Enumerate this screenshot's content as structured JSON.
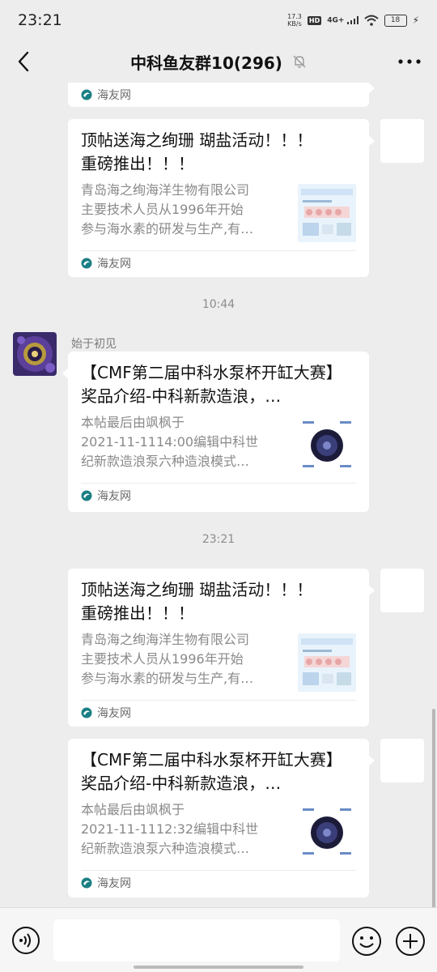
{
  "status_bar": {
    "time": "23:21",
    "net_speed_value": "17.3",
    "net_speed_unit": "KB/s",
    "hd": "HD",
    "signal": "4G+",
    "battery": "18"
  },
  "header": {
    "title": "中科鱼友群10(296)",
    "icons": [
      "back-arrow-icon",
      "mute-bell-icon",
      "more-icon"
    ]
  },
  "messages": {
    "m0": {
      "source": "海友网"
    },
    "m1": {
      "title": "顶帖送海之绚珊 瑚盐活动！！！\n重磅推出！！！",
      "desc": "青岛海之绚海洋生物有限公司\n主要技术人员从1996年开始\n参与海水素的研发与生产,有…",
      "source": "海友网"
    },
    "time1": "10:44",
    "m2": {
      "sender": "始于初见",
      "title": "【CMF第二届中科水泵杯开缸大赛】奖品介绍-中科新款造浪，…",
      "desc": "本帖最后由飒枫于\n2021-11-1114:00编辑中科世\n纪新款造浪泵六种造浪模式…",
      "source": "海友网"
    },
    "time2": "23:21",
    "m3": {
      "title": "顶帖送海之绚珊 瑚盐活动！！！\n重磅推出！！！",
      "desc": "青岛海之绚海洋生物有限公司\n主要技术人员从1996年开始\n参与海水素的研发与生产,有…",
      "source": "海友网"
    },
    "m4": {
      "title": "【CMF第二届中科水泵杯开缸大赛】奖品介绍-中科新款造浪，…",
      "desc": "本帖最后由飒枫于\n2021-11-1112:32编辑中科世\n纪新款造浪泵六种造浪模式…",
      "source": "海友网"
    }
  },
  "input_bar": {
    "placeholder": "",
    "icons": [
      "voice-icon",
      "emoji-icon",
      "plus-icon"
    ]
  },
  "colors": {
    "background": "#ededed",
    "card": "#ffffff",
    "source_green": "#1aad19"
  }
}
